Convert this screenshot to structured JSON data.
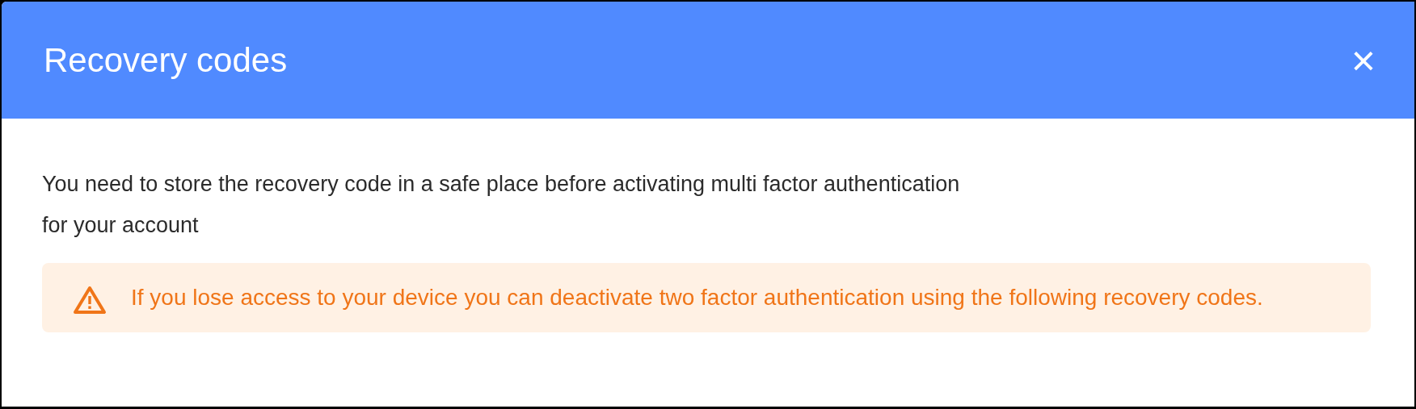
{
  "dialog": {
    "title": "Recovery codes",
    "close": "×"
  },
  "intro": "You need to store the recovery code in a safe place before activating multi factor authentication for your account",
  "alert": {
    "kind": "warning",
    "text": "If you lose access to your device you can deactivate two factor authentication using the following recovery codes."
  }
}
